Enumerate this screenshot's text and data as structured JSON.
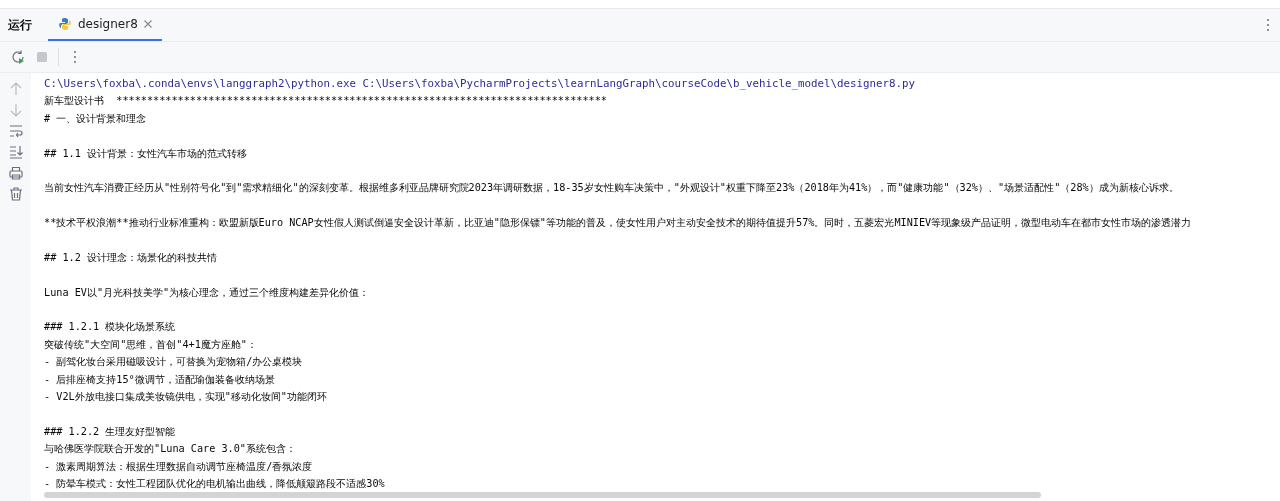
{
  "run_panel": {
    "title": "运行",
    "tabs": [
      {
        "label": "designer8",
        "selected": true
      }
    ]
  },
  "console": {
    "lines": [
      {
        "kind": "command",
        "text": "C:\\Users\\foxba\\.conda\\envs\\langgraph2\\python.exe C:\\Users\\foxba\\PycharmProjects\\learnLangGraph\\courseCode\\b_vehicle_model\\designer8.py"
      },
      {
        "kind": "output",
        "text": "新车型设计书  ********************************************************************************"
      },
      {
        "kind": "output",
        "text": "# 一、设计背景和理念"
      },
      {
        "kind": "blank"
      },
      {
        "kind": "output",
        "text": "## 1.1 设计背景：女性汽车市场的范式转移"
      },
      {
        "kind": "blank"
      },
      {
        "kind": "output",
        "text": "当前女性汽车消费正经历从\"性别符号化\"到\"需求精细化\"的深刻变革。根据维多利亚品牌研究院2023年调研数据，18-35岁女性购车决策中，\"外观设计\"权重下降至23%（2018年为41%），而\"健康功能\"（32%）、\"场景适配性\"（28%）成为新核心诉求。"
      },
      {
        "kind": "blank"
      },
      {
        "kind": "output",
        "text": "**技术平权浪潮**推动行业标准重构：欧盟新版Euro NCAP女性假人测试倒逼安全设计革新，比亚迪\"隐形保镖\"等功能的普及，使女性用户对主动安全技术的期待值提升57%。同时，五菱宏光MINIEV等现象级产品证明，微型电动车在都市女性市场的渗透潜力"
      },
      {
        "kind": "blank"
      },
      {
        "kind": "output",
        "text": "## 1.2 设计理念：场景化的科技共情"
      },
      {
        "kind": "blank"
      },
      {
        "kind": "output",
        "text": "Luna EV以\"月光科技美学\"为核心理念，通过三个维度构建差异化价值："
      },
      {
        "kind": "blank"
      },
      {
        "kind": "output",
        "text": "### 1.2.1 模块化场景系统"
      },
      {
        "kind": "output",
        "text": "突破传统\"大空间\"思维，首创\"4+1魔方座舱\"："
      },
      {
        "kind": "output",
        "text": "- 副驾化妆台采用磁吸设计，可替换为宠物箱/办公桌模块"
      },
      {
        "kind": "output",
        "text": "- 后排座椅支持15°微调节，适配瑜伽装备收纳场景"
      },
      {
        "kind": "output",
        "text": "- V2L外放电接口集成美妆镜供电，实现\"移动化妆间\"功能闭环"
      },
      {
        "kind": "blank"
      },
      {
        "kind": "output",
        "text": "### 1.2.2 生理友好型智能"
      },
      {
        "kind": "output",
        "text": "与哈佛医学院联合开发的\"Luna Care 3.0\"系统包含："
      },
      {
        "kind": "output",
        "text": "- 激素周期算法：根据生理数据自动调节座椅温度/香氛浓度"
      },
      {
        "kind": "output",
        "text": "- 防晕车模式：女性工程团队优化的电机输出曲线，降低颠簸路段不适感30%"
      }
    ]
  }
}
